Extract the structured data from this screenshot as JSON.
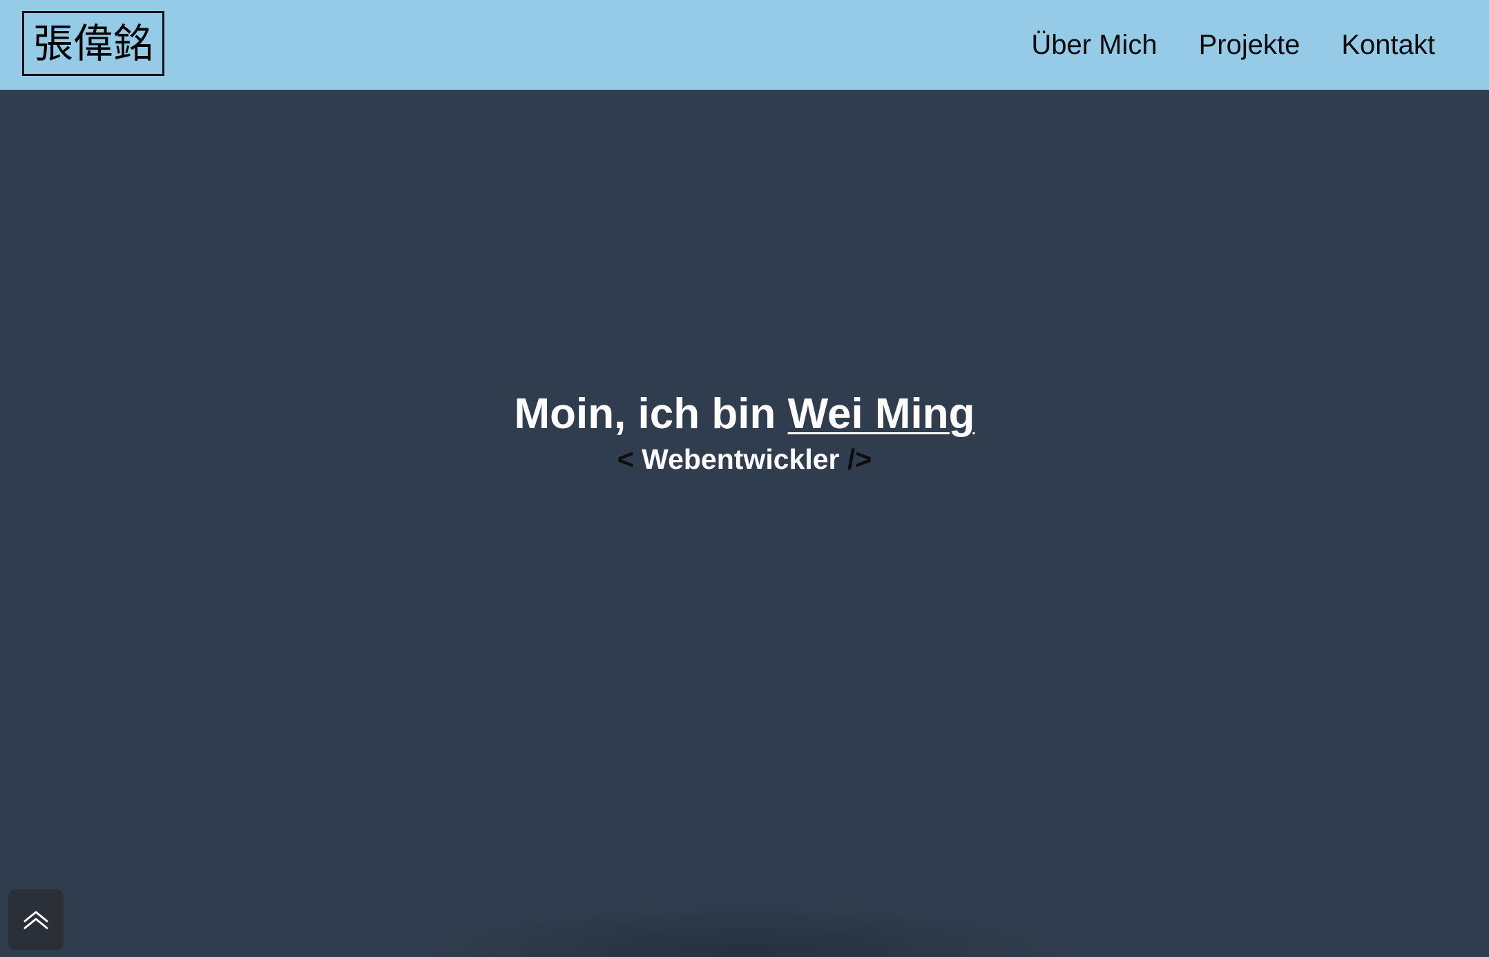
{
  "header": {
    "logo_text": "張偉銘",
    "nav": [
      {
        "label": "Über Mich"
      },
      {
        "label": "Projekte"
      },
      {
        "label": "Kontakt"
      }
    ]
  },
  "hero": {
    "greeting": "Moin, ich bin ",
    "name": "Wei Ming",
    "tag_open": "<",
    "role": "Webentwickler",
    "tag_close": "/>"
  },
  "scroll_top": {
    "icon": "double-chevron-up-icon"
  },
  "colors": {
    "navbar_bg": "#95cbe7",
    "page_bg": "#303d4e",
    "text_light": "#ffffff",
    "text_dark": "#0d0d0d",
    "button_bg": "#2b3038"
  }
}
